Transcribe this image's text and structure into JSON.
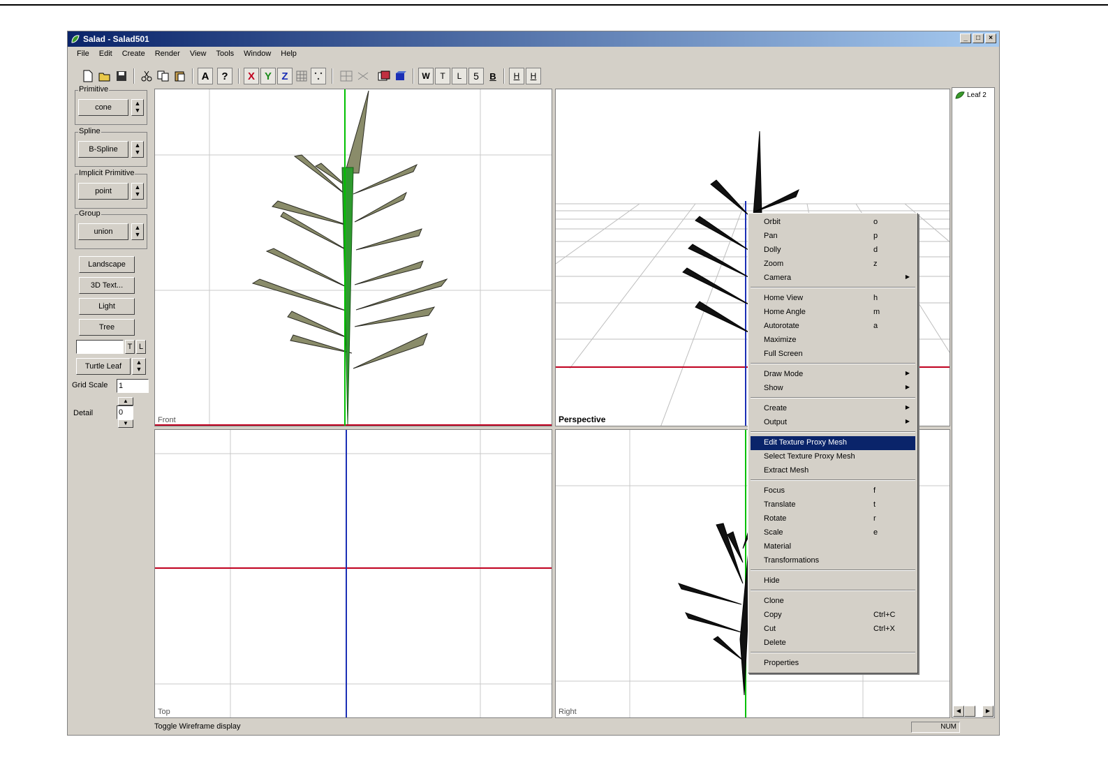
{
  "window": {
    "title": "Salad - Salad501"
  },
  "menu": [
    "File",
    "Edit",
    "Create",
    "Render",
    "View",
    "Tools",
    "Window",
    "Help"
  ],
  "toolbar": {
    "font_btn": "A",
    "help_btn": "?",
    "x_btn": "X",
    "y_btn": "Y",
    "z_btn": "Z",
    "w_btn": "W",
    "t_btn": "T",
    "l_btn": "L",
    "five_btn": "5",
    "b_btn": "B",
    "h1_btn": "H",
    "h2_btn": "H",
    "colors": {
      "x": "#c0001f",
      "y": "#1a8a1a",
      "z": "#1b2fb5"
    }
  },
  "left": {
    "primitive_label": "Primitive",
    "primitive_value": "cone",
    "spline_label": "Spline",
    "spline_value": "B-Spline",
    "implicit_label": "Implicit Primitive",
    "implicit_value": "point",
    "group_label": "Group",
    "group_value": "union",
    "btn_landscape": "Landscape",
    "btn_3dtext": "3D Text...",
    "btn_light": "Light",
    "btn_tree": "Tree",
    "t_btn": "T",
    "l_btn": "L",
    "turtle_btn": "Turtle Leaf",
    "grid_scale_label": "Grid Scale",
    "grid_scale_value": "1",
    "detail_label": "Detail",
    "detail_value": "0"
  },
  "viewports": {
    "front": "Front",
    "perspective": "Perspective",
    "top": "Top",
    "right": "Right"
  },
  "tree": {
    "item": "Leaf 2"
  },
  "status": {
    "text": "Toggle Wireframe display",
    "num": "NUM"
  },
  "context_menu": {
    "items": [
      {
        "label": "Orbit",
        "shortcut": "o"
      },
      {
        "label": "Pan",
        "shortcut": "p"
      },
      {
        "label": "Dolly",
        "shortcut": "d"
      },
      {
        "label": "Zoom",
        "shortcut": "z"
      },
      {
        "label": "Camera",
        "submenu": true
      },
      {
        "label": "Home View",
        "shortcut": "h"
      },
      {
        "label": "Home Angle",
        "shortcut": "m"
      },
      {
        "label": "Autorotate",
        "shortcut": "a"
      },
      {
        "label": "Maximize"
      },
      {
        "label": "Full Screen"
      },
      {
        "label": "Draw Mode",
        "submenu": true
      },
      {
        "label": "Show",
        "submenu": true
      },
      {
        "label": "Create",
        "submenu": true
      },
      {
        "label": "Output",
        "submenu": true
      },
      {
        "label": "Edit Texture Proxy Mesh",
        "highlighted": true
      },
      {
        "label": "Select Texture Proxy Mesh"
      },
      {
        "label": "Extract Mesh"
      },
      {
        "label": "Focus",
        "shortcut": "f"
      },
      {
        "label": "Translate",
        "shortcut": "t"
      },
      {
        "label": "Rotate",
        "shortcut": "r"
      },
      {
        "label": "Scale",
        "shortcut": "e"
      },
      {
        "label": "Material"
      },
      {
        "label": "Transformations"
      },
      {
        "label": "Hide"
      },
      {
        "label": "Clone"
      },
      {
        "label": "Copy",
        "shortcut": "Ctrl+C"
      },
      {
        "label": "Cut",
        "shortcut": "Ctrl+X"
      },
      {
        "label": "Delete"
      },
      {
        "label": "Properties"
      }
    ]
  }
}
